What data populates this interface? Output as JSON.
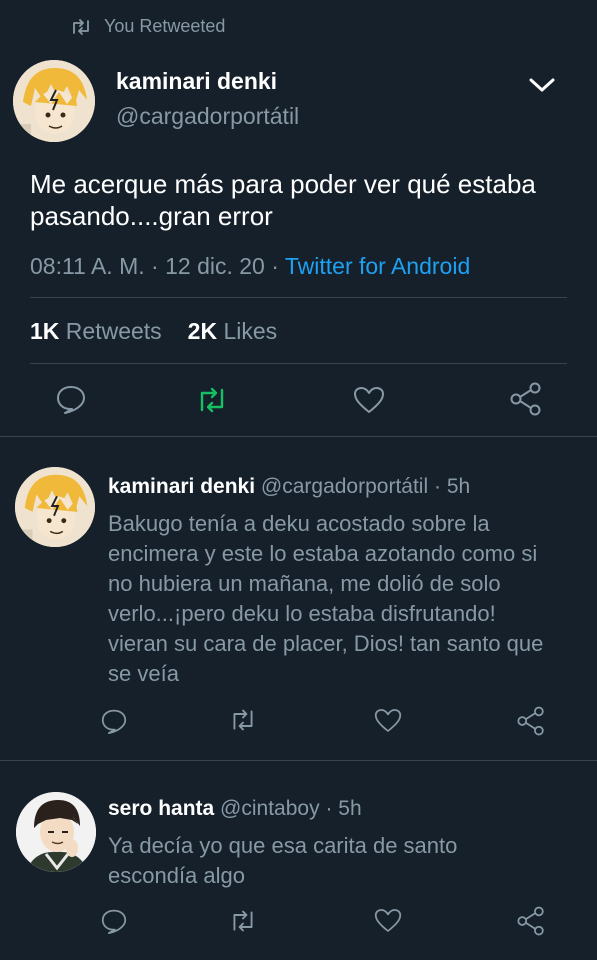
{
  "retweet_banner": {
    "label": "You Retweeted"
  },
  "main_tweet": {
    "author_name": "kaminari denki",
    "author_handle": "@cargadorportátil",
    "text": "Me acerque más para poder ver qué estaba pasando....gran error",
    "time": "08:11 A. M.",
    "date": "12 dic. 20",
    "source": "Twitter for Android",
    "retweet_count": "1K",
    "retweet_label": "Retweets",
    "like_count": "2K",
    "like_label": "Likes",
    "retweet_active_color": "#17bf63"
  },
  "replies": [
    {
      "author_name": "kaminari denki",
      "author_handle": "@cargadorportátil",
      "age": "5h",
      "text": "Bakugo tenía a deku acostado sobre la encimera y este lo estaba azotando como si no hubiera un mañana, me dolió de solo verlo...¡pero deku lo estaba disfrutando! vieran su cara de placer, Dios! tan santo que se veía"
    },
    {
      "author_name": "sero hanta",
      "author_handle": "@cintaboy",
      "age": "5h",
      "text": "Ya decía yo que esa carita de santo escondía algo"
    }
  ],
  "colors": {
    "background": "#15202b",
    "muted_text": "#8899a6",
    "link": "#1da1f2",
    "divider": "#38444d"
  },
  "icons": [
    "retweet-icon",
    "chevron-down-icon",
    "reply-icon",
    "like-icon",
    "share-icon"
  ]
}
